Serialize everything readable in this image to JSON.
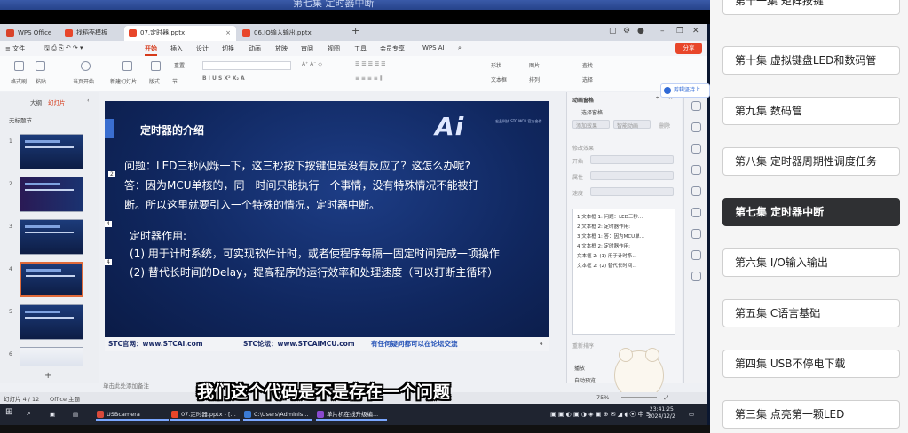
{
  "video_title_fragment": "第七集 定时器中断",
  "window": {
    "tabs": [
      {
        "label": "WPS Office",
        "color": "#d9432a"
      },
      {
        "label": "找稻壳模板",
        "color": "#e8462a"
      },
      {
        "label": "07.定时器.pptx",
        "color": "#e8462a"
      },
      {
        "label": "06.IO输入输出.pptx",
        "color": "#e8462a"
      }
    ],
    "new_tab": "+",
    "menus": [
      "≡ 文件",
      "开始",
      "插入",
      "设计",
      "切换",
      "动画",
      "放映",
      "审阅",
      "视图",
      "工具",
      "会员专享",
      "WPS AI"
    ],
    "active_menu": "开始",
    "share": "分享"
  },
  "ribbon": {
    "labels": [
      "格式刷",
      "粘贴",
      "当页开始",
      "新建幻灯片",
      "版式",
      "节",
      "重置",
      "形状",
      "图片",
      "文本框",
      "排列",
      "查找",
      "选择"
    ]
  },
  "left_pane": {
    "tabs": [
      "大纲",
      "幻灯片"
    ],
    "active_tab": "幻灯片",
    "section": "无标题节",
    "slide_numbers": [
      "1",
      "2",
      "3",
      "4",
      "5",
      "6"
    ],
    "add": "+"
  },
  "slide": {
    "title": "定时器的介绍",
    "logo": "Ai",
    "logo_sub": "宏晶科技 STC MCU 官方合作",
    "lines": [
      "问题：LED三秒闪烁一下，这三秒按下按键但是没有反应了？这怎么办呢?",
      "答：因为MCU单核的，同一时间只能执行一个事情，没有特殊情况不能被打",
      "断。所以这里就要引入一个特殊的情况，定时器中断。",
      "定时器作用:",
      "(1) 用于计时系统，可实现软件计时，或者使程序每隔一固定时间完成一项操作",
      "(2) 替代长时间的Delay，提高程序的运行效率和处理速度（可以打断主循环）"
    ],
    "footer": [
      "STC官网：www.STCAI.com",
      "STC论坛：www.STCAIMCU.com",
      "有任何疑问都可以在论坛交流"
    ],
    "page": "4",
    "markers": [
      "2",
      "4",
      "4"
    ]
  },
  "notes_placeholder": "单击此处添加备注",
  "anim_pane": {
    "title": "动画窗格",
    "select_pane": "选择窗格",
    "buttons": [
      "添加效果",
      "智能动画",
      "删除"
    ],
    "modify": "修改效果",
    "fields": [
      "开始",
      "属性",
      "速度"
    ],
    "items": [
      "1  文本框 1: 问题：LED三秒...",
      "2  文本框 2: 定时器作用:",
      "3  文本框 1: 答：因为MCU单...",
      "4  文本框 2: 定时器作用:",
      "    文本框 2: (1) 用于计时系...",
      "    文本框 2: (2) 替代长时间..."
    ],
    "reorder": "重新排序",
    "play": "播放",
    "autopreview": "自动预览"
  },
  "badge": "剪辑坚持上",
  "status": {
    "slide_info": "幻灯片 4 / 12",
    "theme": "Office 主题",
    "zoom": "75%"
  },
  "taskbar": {
    "apps": [
      {
        "label": "USBcamera",
        "color": "#d94a3a"
      },
      {
        "label": "07.定时器.pptx - [...",
        "color": "#e8462a"
      },
      {
        "label": "C:\\Users\\Adminis...",
        "color": "#3a7bd5"
      },
      {
        "label": "单片机在线升级编...",
        "color": "#8a4ad0"
      }
    ],
    "time": "23:41:25",
    "date": "2024/12/2"
  },
  "subtitle": "我们这个代码是不是存在一个问题",
  "episodes": [
    {
      "label": "第十一集 矩阵按键",
      "active": false
    },
    {
      "label": "第十集 虚拟键盘LED和数码管",
      "active": false
    },
    {
      "label": "第九集 数码管",
      "active": false
    },
    {
      "label": "第八集 定时器周期性调度任务",
      "active": false
    },
    {
      "label": "第七集 定时器中断",
      "active": true
    },
    {
      "label": "第六集 I/O输入输出",
      "active": false
    },
    {
      "label": "第五集 C语言基础",
      "active": false
    },
    {
      "label": "第四集 USB不停电下载",
      "active": false
    },
    {
      "label": "第三集 点亮第一颗LED",
      "active": false
    }
  ]
}
